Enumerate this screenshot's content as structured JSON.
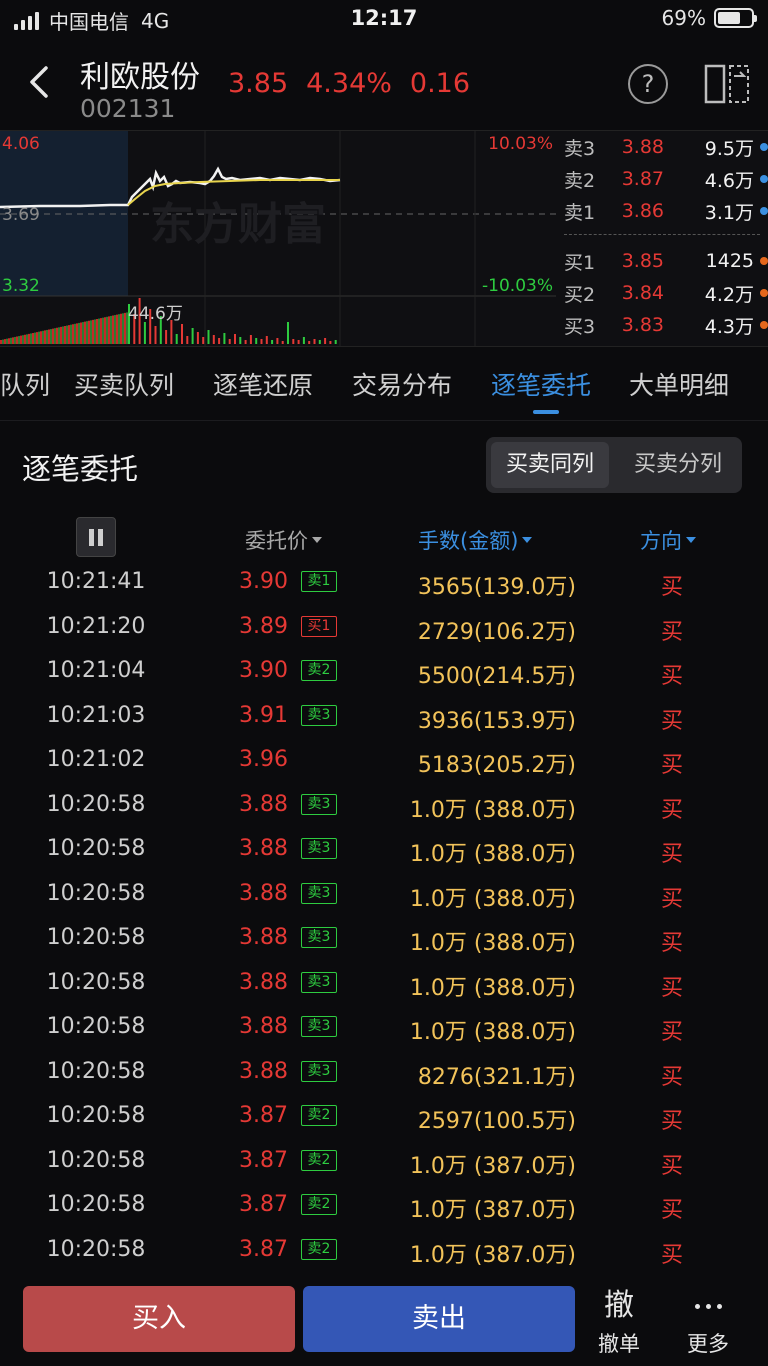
{
  "status": {
    "carrier": "中国电信",
    "network": "4G",
    "time": "12:17",
    "battery": "69%",
    "battery_level": 0.69
  },
  "header": {
    "name": "利欧股份",
    "code": "002131",
    "price": "3.85",
    "change_pct": "4.34%",
    "change": "0.16"
  },
  "chart": {
    "high": "4.06",
    "mid": "3.69",
    "low": "3.32",
    "up_pct": "10.03%",
    "down_pct": "-10.03%",
    "volume": "44.6万",
    "watermark": "东方财富"
  },
  "orderbook": {
    "asks": [
      {
        "label": "卖3",
        "price": "3.88",
        "vol": "9.5万",
        "dot": "#3b8fe0"
      },
      {
        "label": "卖2",
        "price": "3.87",
        "vol": "4.6万",
        "dot": "#3b8fe0"
      },
      {
        "label": "卖1",
        "price": "3.86",
        "vol": "3.1万",
        "dot": "#3b8fe0"
      }
    ],
    "bids": [
      {
        "label": "买1",
        "price": "3.85",
        "vol": "1425",
        "dot": "#e5671c"
      },
      {
        "label": "买2",
        "price": "3.84",
        "vol": "4.2万",
        "dot": "#e5671c"
      },
      {
        "label": "买3",
        "price": "3.83",
        "vol": "4.3万",
        "dot": "#e5671c"
      }
    ]
  },
  "tabs": [
    {
      "label": "队列"
    },
    {
      "label": "买卖队列"
    },
    {
      "label": "逐笔还原"
    },
    {
      "label": "交易分布"
    },
    {
      "label": "逐笔委托"
    },
    {
      "label": "大单明细"
    }
  ],
  "section": {
    "title": "逐笔委托",
    "seg_same": "买卖同列",
    "seg_split": "买卖分列"
  },
  "columns": {
    "price": "委托价",
    "amount": "手数(金额)",
    "direction": "方向"
  },
  "rows": [
    {
      "time": "10:21:41",
      "price": "3.90",
      "tag": "卖1",
      "tag_type": "sell",
      "amount": "3565(139.0万)",
      "dir": "买"
    },
    {
      "time": "10:21:20",
      "price": "3.89",
      "tag": "买1",
      "tag_type": "buy",
      "amount": "2729(106.2万)",
      "dir": "买"
    },
    {
      "time": "10:21:04",
      "price": "3.90",
      "tag": "卖2",
      "tag_type": "sell",
      "amount": "5500(214.5万)",
      "dir": "买"
    },
    {
      "time": "10:21:03",
      "price": "3.91",
      "tag": "卖3",
      "tag_type": "sell",
      "amount": "3936(153.9万)",
      "dir": "买"
    },
    {
      "time": "10:21:02",
      "price": "3.96",
      "tag": "",
      "tag_type": "",
      "amount": "5183(205.2万)",
      "dir": "买"
    },
    {
      "time": "10:20:58",
      "price": "3.88",
      "tag": "卖3",
      "tag_type": "sell",
      "amount": "1.0万 (388.0万)",
      "dir": "买"
    },
    {
      "time": "10:20:58",
      "price": "3.88",
      "tag": "卖3",
      "tag_type": "sell",
      "amount": "1.0万 (388.0万)",
      "dir": "买"
    },
    {
      "time": "10:20:58",
      "price": "3.88",
      "tag": "卖3",
      "tag_type": "sell",
      "amount": "1.0万 (388.0万)",
      "dir": "买"
    },
    {
      "time": "10:20:58",
      "price": "3.88",
      "tag": "卖3",
      "tag_type": "sell",
      "amount": "1.0万 (388.0万)",
      "dir": "买"
    },
    {
      "time": "10:20:58",
      "price": "3.88",
      "tag": "卖3",
      "tag_type": "sell",
      "amount": "1.0万 (388.0万)",
      "dir": "买"
    },
    {
      "time": "10:20:58",
      "price": "3.88",
      "tag": "卖3",
      "tag_type": "sell",
      "amount": "1.0万 (388.0万)",
      "dir": "买"
    },
    {
      "time": "10:20:58",
      "price": "3.88",
      "tag": "卖3",
      "tag_type": "sell",
      "amount": "8276(321.1万)",
      "dir": "买"
    },
    {
      "time": "10:20:58",
      "price": "3.87",
      "tag": "卖2",
      "tag_type": "sell",
      "amount": "2597(100.5万)",
      "dir": "买"
    },
    {
      "time": "10:20:58",
      "price": "3.87",
      "tag": "卖2",
      "tag_type": "sell",
      "amount": "1.0万 (387.0万)",
      "dir": "买"
    },
    {
      "time": "10:20:58",
      "price": "3.87",
      "tag": "卖2",
      "tag_type": "sell",
      "amount": "1.0万 (387.0万)",
      "dir": "买"
    },
    {
      "time": "10:20:58",
      "price": "3.87",
      "tag": "卖2",
      "tag_type": "sell",
      "amount": "1.0万 (387.0万)",
      "dir": "买"
    }
  ],
  "bottom": {
    "buy": "买入",
    "sell": "卖出",
    "cancel_big": "撤",
    "cancel": "撤单",
    "more": "更多"
  },
  "colors": {
    "up": "#e53935",
    "down": "#2ecc40",
    "accent": "#3b8fe0",
    "amount": "#f2c35a"
  }
}
